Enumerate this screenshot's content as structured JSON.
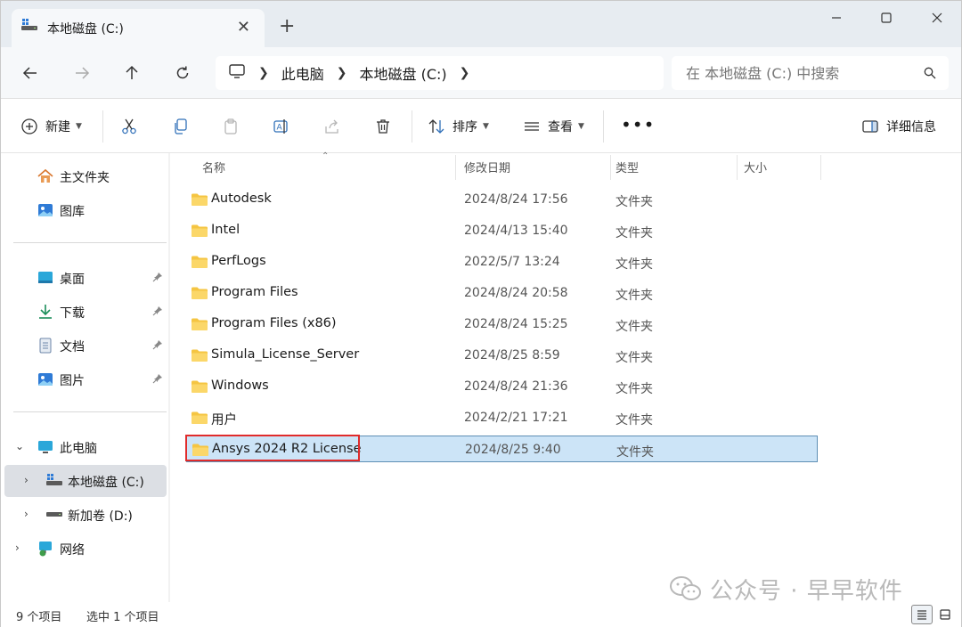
{
  "tab": {
    "title": "本地磁盘 (C:)",
    "close": "✕",
    "new_tab": "+"
  },
  "window_controls": {
    "minimize": "—",
    "maximize": "☐",
    "close": "✕"
  },
  "address": {
    "segments": [
      "此电脑",
      "本地磁盘 (C:)"
    ]
  },
  "search": {
    "placeholder": "在 本地磁盘 (C:) 中搜索"
  },
  "toolbar": {
    "new_label": "新建",
    "sort_label": "排序",
    "view_label": "查看",
    "more_label": "•••",
    "details_label": "详细信息"
  },
  "sidebar": {
    "top": [
      {
        "label": "主文件夹",
        "icon": "home-icon"
      },
      {
        "label": "图库",
        "icon": "gallery-icon"
      }
    ],
    "pinned": [
      {
        "label": "桌面",
        "icon": "desktop-icon"
      },
      {
        "label": "下载",
        "icon": "download-icon"
      },
      {
        "label": "文档",
        "icon": "document-icon"
      },
      {
        "label": "图片",
        "icon": "pictures-icon"
      }
    ],
    "this_pc": "此电脑",
    "drives": [
      {
        "label": "本地磁盘 (C:)",
        "selected": true
      },
      {
        "label": "新加卷 (D:)",
        "selected": false
      }
    ],
    "network": "网络"
  },
  "columns": {
    "name": "名称",
    "date": "修改日期",
    "type": "类型",
    "size": "大小"
  },
  "files": [
    {
      "name": "Autodesk",
      "date": "2024/8/24 17:56",
      "type": "文件夹"
    },
    {
      "name": "Intel",
      "date": "2024/4/13 15:40",
      "type": "文件夹"
    },
    {
      "name": "PerfLogs",
      "date": "2022/5/7 13:24",
      "type": "文件夹"
    },
    {
      "name": "Program Files",
      "date": "2024/8/24 20:58",
      "type": "文件夹"
    },
    {
      "name": "Program Files (x86)",
      "date": "2024/8/24 15:25",
      "type": "文件夹"
    },
    {
      "name": "Simula_License_Server",
      "date": "2024/8/25 8:59",
      "type": "文件夹"
    },
    {
      "name": "Windows",
      "date": "2024/8/24 21:36",
      "type": "文件夹"
    },
    {
      "name": "用户",
      "date": "2024/2/21 17:21",
      "type": "文件夹"
    },
    {
      "name": "Ansys 2024 R2 License",
      "date": "2024/8/25 9:40",
      "type": "文件夹",
      "selected": true
    }
  ],
  "status": {
    "count": "9 个项目",
    "selection": "选中 1 个项目"
  },
  "watermark": {
    "text": "公众号 · 早早软件"
  },
  "colors": {
    "accent": "#cce4f7",
    "highlight": "#e02b2b",
    "folder": "#f5c542"
  }
}
